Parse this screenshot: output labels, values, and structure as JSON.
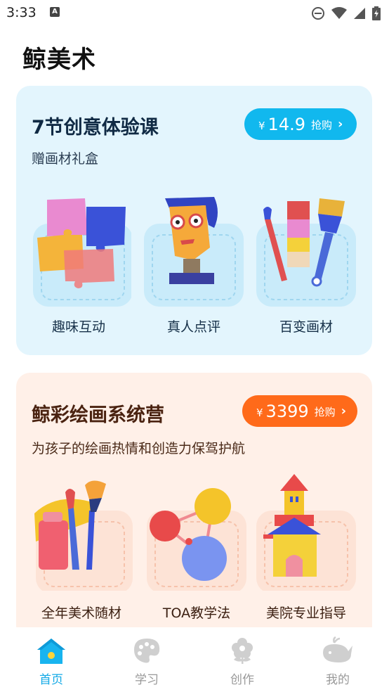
{
  "status": {
    "time": "3:33",
    "notification_icon_letter": "A"
  },
  "app_title": "鲸美术",
  "cards": [
    {
      "title": "7节创意体验课",
      "subtitle": "赠画材礼盒",
      "price_symbol": "¥",
      "price": "14.9",
      "buy_label": "抢购",
      "accent": "#11b8ee",
      "features": [
        {
          "label": "趣味互动",
          "icon": "puzzle-icon"
        },
        {
          "label": "真人点评",
          "icon": "teacher-icon"
        },
        {
          "label": "百变画材",
          "icon": "paint-tools-icon"
        }
      ]
    },
    {
      "title": "鲸彩绘画系统营",
      "subtitle": "为孩子的绘画热情和创造力保驾护航",
      "price_symbol": "¥",
      "price": "3399",
      "buy_label": "抢购",
      "accent": "#ff6a1a",
      "features": [
        {
          "label": "全年美术随材",
          "icon": "art-supplies-icon"
        },
        {
          "label": "TOA教学法",
          "icon": "molecule-icon"
        },
        {
          "label": "美院专业指导",
          "icon": "castle-icon"
        }
      ]
    }
  ],
  "nav": {
    "items": [
      {
        "label": "首页",
        "icon": "home-icon",
        "active": true
      },
      {
        "label": "学习",
        "icon": "palette-icon",
        "active": false
      },
      {
        "label": "创作",
        "icon": "flower-icon",
        "active": false
      },
      {
        "label": "我的",
        "icon": "whale-icon",
        "active": false
      }
    ],
    "active_color": "#12a9e6",
    "inactive_color": "#999999"
  }
}
